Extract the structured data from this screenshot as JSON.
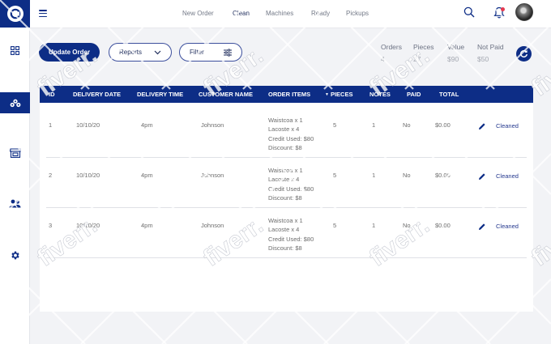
{
  "sidebar": {
    "items": [
      {
        "icon": "grid-icon"
      },
      {
        "icon": "orders-icon",
        "active": true
      },
      {
        "icon": "store-icon"
      },
      {
        "icon": "users-icon"
      },
      {
        "icon": "gear-icon"
      }
    ]
  },
  "nav": {
    "items": [
      "New Order",
      "Clean",
      "Machines",
      "Ready",
      "Pickups"
    ],
    "active": "Clean"
  },
  "toolbar": {
    "update_label": "Update Order",
    "reports_label": "Reports",
    "filter_label": "Filter"
  },
  "stats": [
    {
      "label": "Orders",
      "value": "4"
    },
    {
      "label": "Pieces",
      "value": "27"
    },
    {
      "label": "Value",
      "value": "$90"
    },
    {
      "label": "Not Paid",
      "value": "$50"
    }
  ],
  "table": {
    "columns": [
      "ID",
      "DELIVERY DATE",
      "DELIVERY TIME",
      "CUSTOMER NAME",
      "ORDER ITEMS",
      "PIECES",
      "NOTES",
      "PAID",
      "TOTAL"
    ],
    "rows": [
      {
        "id": "1",
        "date": "10/10/20",
        "time": "4pm",
        "customer": "Johnson",
        "items": [
          "Waistcoa x 1",
          "Lacoste x 4",
          "Credit Used: $80",
          "Discount: $8"
        ],
        "pieces": "5",
        "notes": "1",
        "paid": "No",
        "total": "$0.00",
        "status": "Cleaned"
      },
      {
        "id": "2",
        "date": "10/10/20",
        "time": "4pm",
        "customer": "Johnson",
        "items": [
          "Waistcoa x 1",
          "Lacoste x 4",
          "Credit Used: $80",
          "Discount: $8"
        ],
        "pieces": "5",
        "notes": "1",
        "paid": "No",
        "total": "$0.00",
        "status": "Cleaned"
      },
      {
        "id": "3",
        "date": "10/10/20",
        "time": "4pm",
        "customer": "Johnson",
        "items": [
          "Waistcoa x 1",
          "Lacoste x 4",
          "Credit Used: $80",
          "Discount: $8"
        ],
        "pieces": "5",
        "notes": "1",
        "paid": "No",
        "total": "$0.00",
        "status": "Cleaned"
      }
    ]
  },
  "colors": {
    "brand": "#0d2d86",
    "accent_status": "#24388e",
    "notification": "#e53950"
  },
  "watermark": "fiverr."
}
